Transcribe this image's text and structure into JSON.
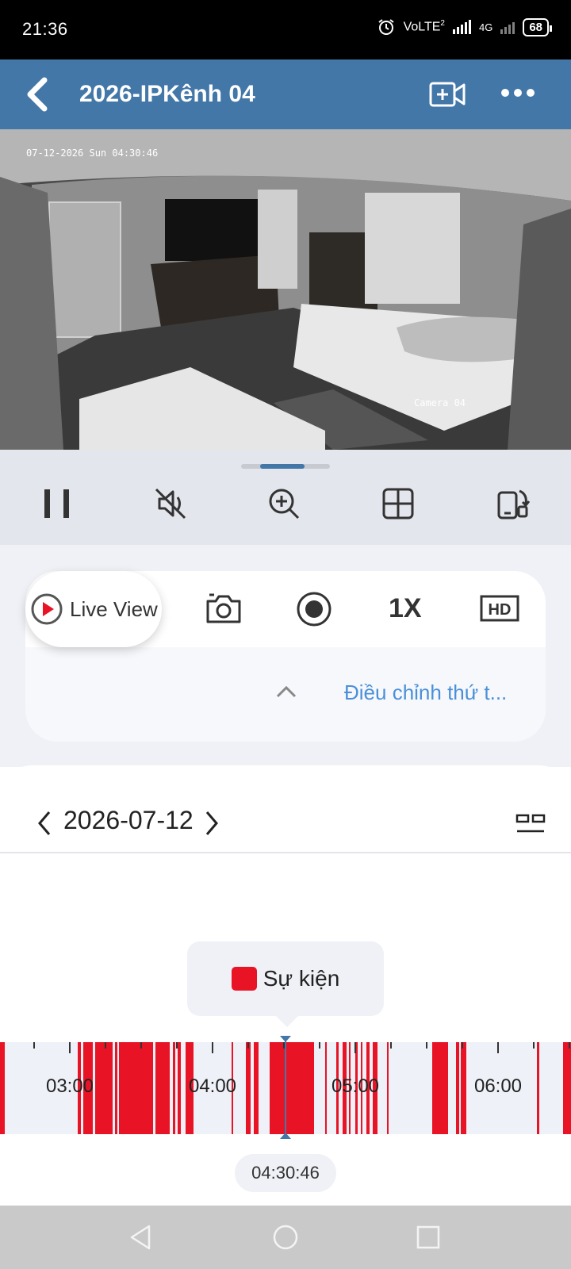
{
  "status_bar": {
    "time": "21:36",
    "network": "VoLTE",
    "sim": "2",
    "net_type": "4G",
    "battery": "68"
  },
  "app_bar": {
    "title": "2026-IPKênh 04",
    "back_icon": "back-chevron-icon",
    "add_icon": "add-camera-icon",
    "more_icon": "more-dots-icon"
  },
  "video": {
    "timestamp": "07-12-2026 Sun 04:30:46",
    "camera_label": "Camera 04"
  },
  "player_controls": [
    "pause-icon",
    "mute-icon",
    "zoom-in-icon",
    "grid-view-icon",
    "rotate-screen-icon"
  ],
  "toolbar": {
    "live_view_label": "Live View",
    "speed_label": "1X",
    "quality_label": "HD",
    "adjust_label": "Điều chỉnh thứ t..."
  },
  "date_nav": {
    "date": "2026-07-12"
  },
  "legend": {
    "label": "Sự kiện",
    "color": "#e81426"
  },
  "timeline": {
    "hours": [
      "03:00",
      "04:00",
      "05:00",
      "06:00"
    ],
    "current_time": "04:30:46",
    "event_color": "#e81426"
  },
  "colors": {
    "accent": "#4277a8",
    "link": "#4a90d9",
    "event": "#e81426"
  }
}
